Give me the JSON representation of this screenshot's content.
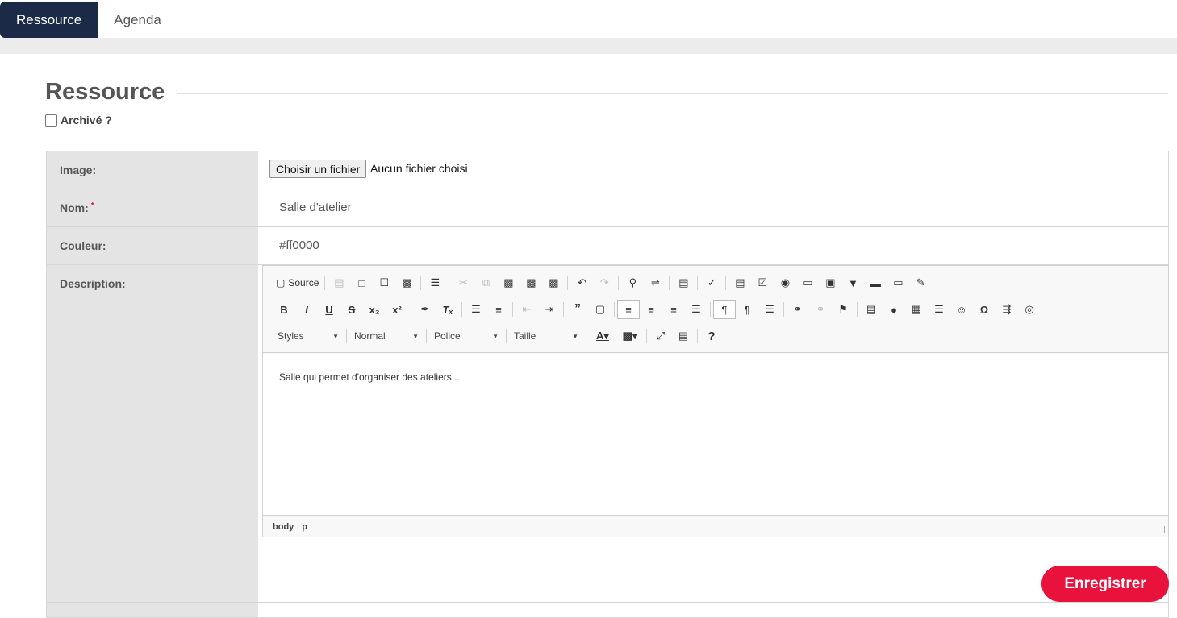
{
  "tabs": [
    {
      "label": "Ressource",
      "active": true
    },
    {
      "label": "Agenda",
      "active": false
    }
  ],
  "heading": "Ressource",
  "archive_label": "Archivé ?",
  "archive_checked": false,
  "fields": {
    "image": {
      "label": "Image:",
      "button": "Choisir un fichier",
      "status": "Aucun fichier choisi"
    },
    "nom": {
      "label": "Nom:",
      "required_mark": "*",
      "value": "Salle d'atelier"
    },
    "couleur": {
      "label": "Couleur:",
      "value": "#ff0000"
    },
    "description": {
      "label": "Description:"
    }
  },
  "editor": {
    "source_label": "Source",
    "styles_label": "Styles",
    "format_label": "Normal",
    "font_label": "Police",
    "size_label": "Taille",
    "content": "Salle qui permet d'organiser des ateliers...",
    "path": [
      "body",
      "p"
    ],
    "help_label": "?"
  },
  "save_label": "Enregistrer",
  "colors": {
    "tab_active": "#1b2a47",
    "save": "#e8123d",
    "label_bg": "#e4e4e4"
  }
}
